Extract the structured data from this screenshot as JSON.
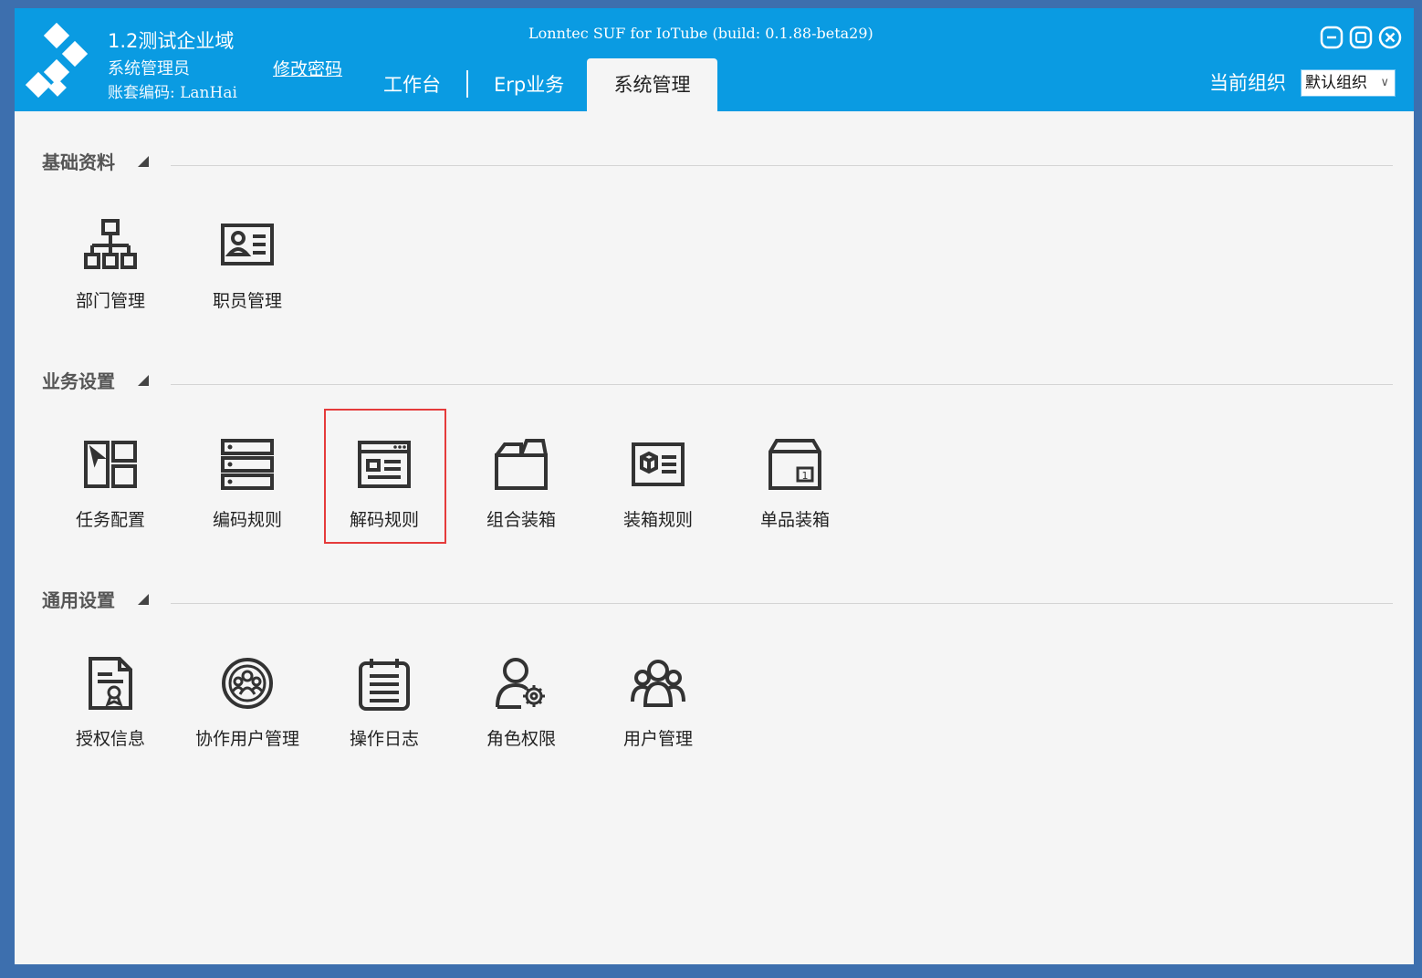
{
  "header": {
    "org_name": "1.2测试企业域",
    "user_role": "系统管理员",
    "account": "账套编码: LanHai",
    "change_password": "修改密码",
    "build_info": "Lonntec SUF for IoTube (build: 0.1.88-beta29)",
    "tabs": [
      {
        "label": "工作台",
        "active": false
      },
      {
        "label": "Erp业务",
        "active": false
      },
      {
        "label": "系统管理",
        "active": true
      }
    ],
    "current_org_label": "当前组织",
    "current_org_value": "默认组织",
    "accent_color": "#0a9be2"
  },
  "sections": [
    {
      "title": "基础资料",
      "items": [
        {
          "label": "部门管理",
          "icon": "org-chart-icon"
        },
        {
          "label": "职员管理",
          "icon": "id-card-icon"
        }
      ]
    },
    {
      "title": "业务设置",
      "items": [
        {
          "label": "任务配置",
          "icon": "task-layout-icon"
        },
        {
          "label": "编码规则",
          "icon": "server-stack-icon"
        },
        {
          "label": "解码规则",
          "icon": "browser-window-icon",
          "selected": true
        },
        {
          "label": "组合装箱",
          "icon": "open-box-icon"
        },
        {
          "label": "装箱规则",
          "icon": "box-card-icon"
        },
        {
          "label": "单品装箱",
          "icon": "single-box-icon"
        }
      ]
    },
    {
      "title": "通用设置",
      "items": [
        {
          "label": "授权信息",
          "icon": "certificate-icon"
        },
        {
          "label": "协作用户管理",
          "icon": "group-circle-icon"
        },
        {
          "label": "操作日志",
          "icon": "notepad-icon"
        },
        {
          "label": "角色权限",
          "icon": "user-gear-icon"
        },
        {
          "label": "用户管理",
          "icon": "users-icon"
        }
      ]
    }
  ]
}
